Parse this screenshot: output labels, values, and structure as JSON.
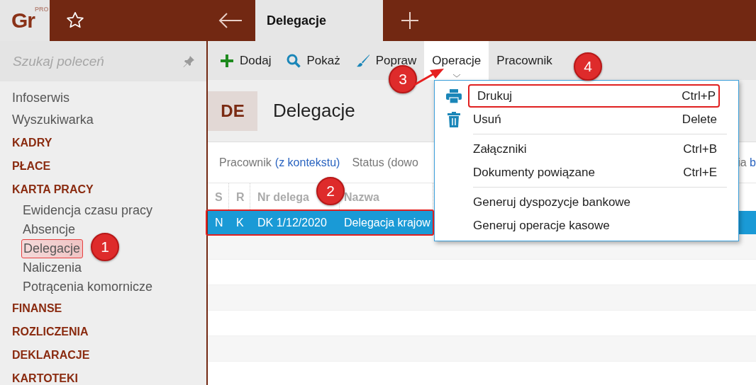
{
  "app": {
    "logo": "Gr",
    "logo_badge": "PRO"
  },
  "tabs": [
    {
      "label": "Delegacje",
      "selected": true
    }
  ],
  "search": {
    "placeholder": "Szukaj poleceń"
  },
  "sidebar": {
    "items": [
      {
        "label": "Infoserwis",
        "kind": "link"
      },
      {
        "label": "Wyszukiwarka",
        "kind": "link"
      },
      {
        "label": "KADRY",
        "kind": "section"
      },
      {
        "label": "PŁACE",
        "kind": "section"
      },
      {
        "label": "KARTA PRACY",
        "kind": "section",
        "children": [
          {
            "label": "Ewidencja czasu pracy",
            "highlighted": false
          },
          {
            "label": "Absencje",
            "highlighted": false
          },
          {
            "label": "Delegacje",
            "highlighted": true
          },
          {
            "label": "Naliczenia",
            "highlighted": false
          },
          {
            "label": "Potrącenia komornicze",
            "highlighted": false
          }
        ]
      },
      {
        "label": "FINANSE",
        "kind": "section"
      },
      {
        "label": "ROZLICZENIA",
        "kind": "section"
      },
      {
        "label": "DEKLARACJE",
        "kind": "section"
      },
      {
        "label": "KARTOTEKI",
        "kind": "section"
      }
    ]
  },
  "toolbar": [
    {
      "label": "Dodaj",
      "selected": false
    },
    {
      "label": "Pokaż",
      "selected": false
    },
    {
      "label": "Popraw",
      "selected": false
    },
    {
      "label": "Operacje",
      "selected": true
    },
    {
      "label": "Pracownik",
      "selected": false
    }
  ],
  "page": {
    "badge": "DE",
    "title": "Delegacje"
  },
  "filters": {
    "label": "Pracownik",
    "link": "(z kontekstu)",
    "status": "Status (dowo",
    "right_text": "ia",
    "right_link": "b"
  },
  "table": {
    "columns": [
      "S",
      "R",
      "Nr delega",
      "Nazwa"
    ],
    "rows": [
      {
        "cells": [
          "N",
          "K",
          "DK 1/12/2020",
          "Delegacja krajow"
        ],
        "selected": true
      }
    ]
  },
  "menu": {
    "groups": [
      [
        {
          "label": "Drukuj",
          "shortcut": "Ctrl+P",
          "highlighted": true
        },
        {
          "label": "Usuń",
          "shortcut": "Delete",
          "highlighted": false
        }
      ],
      [
        {
          "label": "Załączniki",
          "shortcut": "Ctrl+B",
          "highlighted": false
        },
        {
          "label": "Dokumenty powiązane",
          "shortcut": "Ctrl+E",
          "highlighted": false
        }
      ],
      [
        {
          "label": "Generuj dyspozycje bankowe",
          "highlighted": false
        },
        {
          "label": "Generuj operacje kasowe",
          "highlighted": false
        }
      ]
    ]
  },
  "annotations": [
    {
      "number": "1"
    },
    {
      "number": "2"
    },
    {
      "number": "3"
    },
    {
      "number": "4"
    }
  ]
}
